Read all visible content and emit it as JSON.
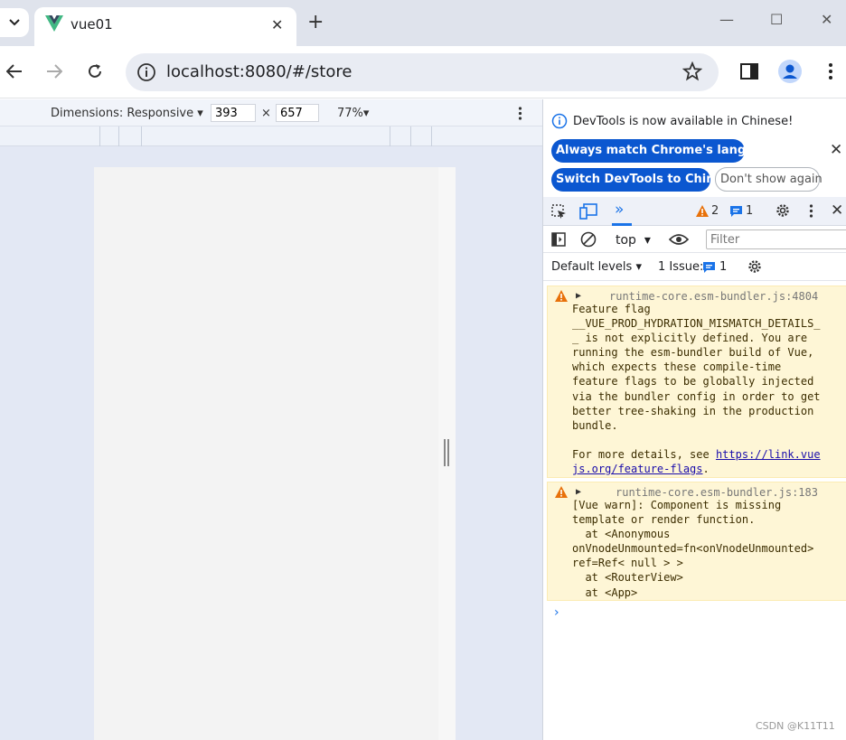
{
  "browser": {
    "tab_title": "vue01",
    "tab_close": "✕",
    "new_tab": "+",
    "url": "localhost:8080/#/store",
    "window_controls": [
      "—",
      "☐",
      "✕"
    ]
  },
  "device_toolbar": {
    "dimensions_label": "Dimensions: Responsive",
    "width": "393",
    "times": "×",
    "height": "657",
    "zoom": "77%"
  },
  "devtools": {
    "infobar": {
      "message": "DevTools is now available in Chinese!",
      "btn_match": "Always match Chrome's language",
      "btn_switch": "Switch DevTools to Chinese",
      "btn_dont_show": "Don't show again"
    },
    "tabs": {
      "warnings_count": "2",
      "messages_count": "1"
    },
    "console_bar": {
      "context": "top",
      "filter_placeholder": "Filter"
    },
    "levels_bar": {
      "levels": "Default levels",
      "issues_label": "1 Issue:",
      "issues_count": "1"
    },
    "messages": [
      {
        "source": "runtime-core.esm-bundler.js:4804",
        "lines": [
          "Feature flag",
          "__VUE_PROD_HYDRATION_MISMATCH_DETAILS_",
          "_ is not explicitly defined. You are",
          "running the esm-bundler build of Vue,",
          "which expects these compile-time",
          "feature flags to be globally injected",
          "via the bundler config in order to get",
          "better tree-shaking in the production",
          "bundle.",
          "",
          "For more details, see "
        ],
        "link_part1": "https://link.vue",
        "link_part2": "js.org/feature-flags",
        "link_tail": "."
      },
      {
        "source": "runtime-core.esm-bundler.js:183",
        "lines": [
          "[Vue warn]: Component is missing",
          "template or render function.",
          "  at <Anonymous",
          "onVnodeUnmounted=fn<onVnodeUnmounted>",
          "ref=Ref< null > >",
          "  at <RouterView>",
          "  at <App>"
        ]
      }
    ],
    "prompt": "›"
  },
  "watermark": "CSDN @K11T11",
  "colors": {
    "accent": "#0b57d0",
    "warn_bg": "#fef6d6",
    "warn_icon": "#e8710a"
  }
}
